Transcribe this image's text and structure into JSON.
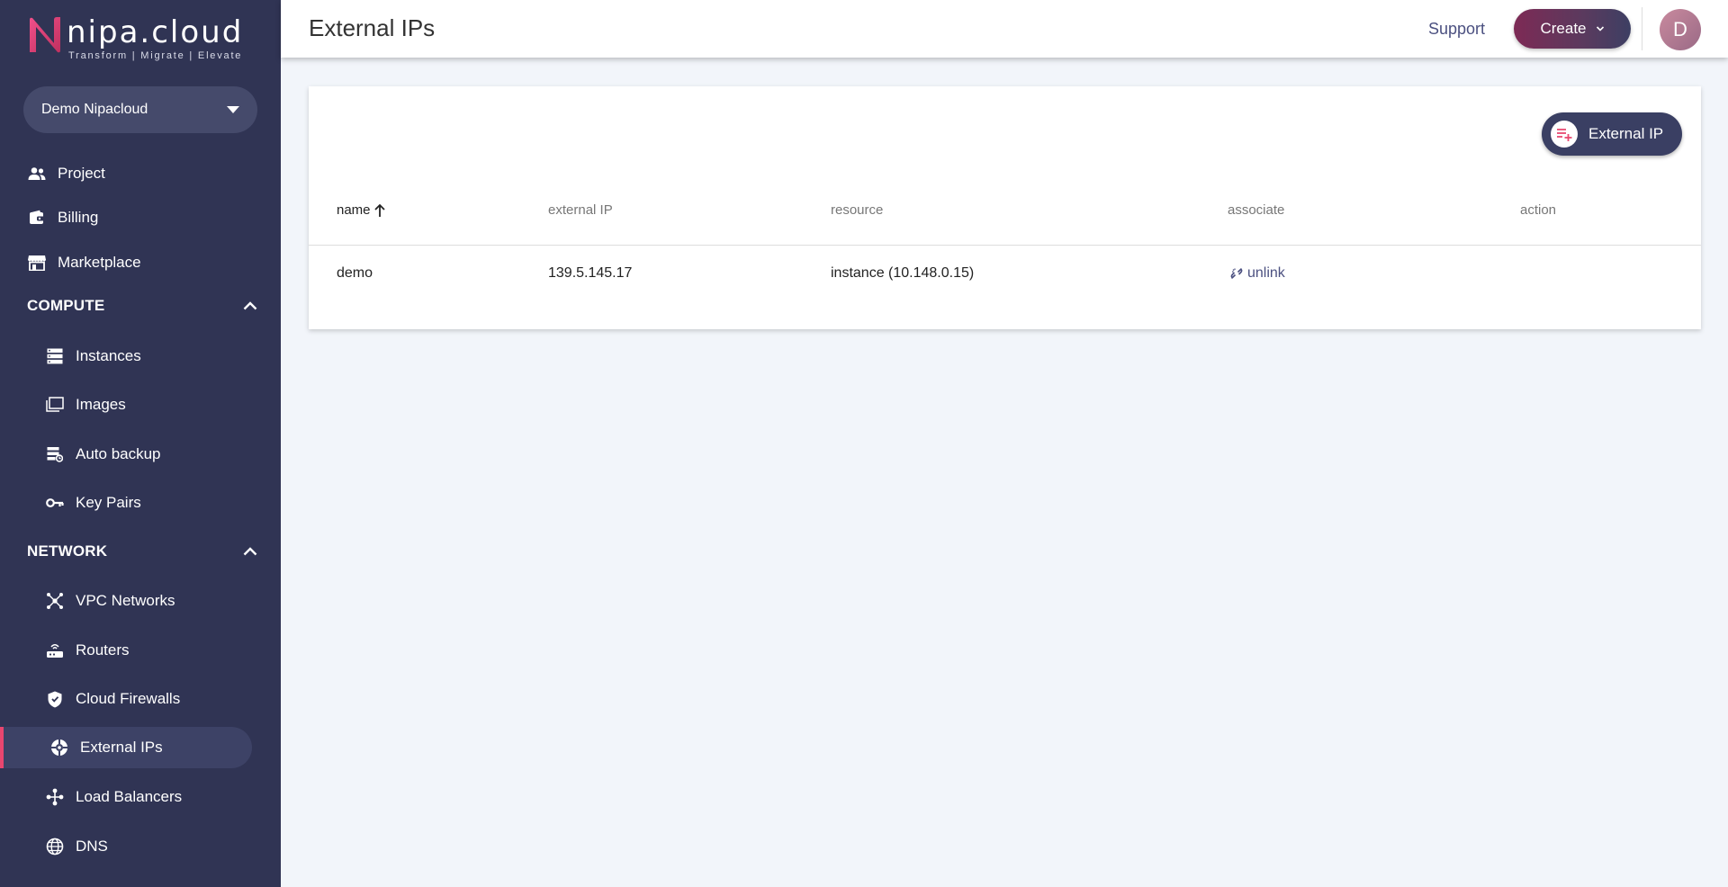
{
  "brand": {
    "logo_text": "nipa.cloud",
    "tagline": "Transform  |  Migrate  |  Elevate",
    "accent": "#e8466f",
    "sidebar_bg": "#303454"
  },
  "project": {
    "selected": "Demo Nipacloud"
  },
  "nav": {
    "project": "Project",
    "billing": "Billing",
    "marketplace": "Marketplace",
    "compute_header": "COMPUTE",
    "instances": "Instances",
    "images": "Images",
    "auto_backup": "Auto backup",
    "key_pairs": "Key Pairs",
    "network_header": "NETWORK",
    "vpc_networks": "VPC Networks",
    "routers": "Routers",
    "cloud_firewalls": "Cloud Firewalls",
    "external_ips": "External IPs",
    "load_balancers": "Load Balancers",
    "dns": "DNS"
  },
  "header": {
    "title": "External IPs",
    "support": "Support",
    "create": "Create",
    "avatar_initial": "D"
  },
  "toolbar": {
    "add_external_ip": "External IP"
  },
  "table": {
    "columns": [
      "name",
      "external IP",
      "resource",
      "associate",
      "action"
    ],
    "rows": [
      {
        "name": "demo",
        "external_ip": "139.5.145.17",
        "resource": "instance (10.148.0.15)",
        "associate": "unlink",
        "action": ""
      }
    ]
  }
}
